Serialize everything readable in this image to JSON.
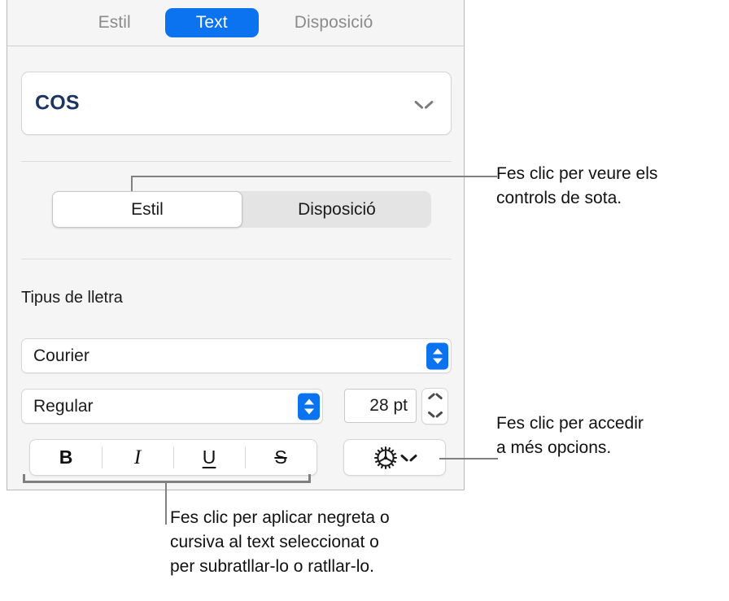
{
  "panel": {
    "top_tabs": [
      {
        "label": "Estil",
        "selected": false
      },
      {
        "label": "Text",
        "selected": true
      },
      {
        "label": "Disposició",
        "selected": false
      }
    ],
    "style_popup": {
      "value": "COS",
      "chevron_icon": "chevron-down-icon",
      "value_color": "#1c3560"
    },
    "segmented_control": [
      {
        "label": "Estil",
        "selected": true
      },
      {
        "label": "Disposició",
        "selected": false
      }
    ],
    "font_section": {
      "label": "Tipus de lletra",
      "family": "Courier",
      "style": "Regular",
      "size": "28 pt",
      "family_stepper_icon": "updown-stepper-icon",
      "style_stepper_icon": "updown-stepper-icon",
      "size_stepper_icon": "updown-chevron-stepper-icon"
    },
    "text_format_buttons": [
      {
        "name": "bold",
        "label": "B"
      },
      {
        "name": "italic",
        "label": "I"
      },
      {
        "name": "underline",
        "label": "U"
      },
      {
        "name": "strikethrough",
        "label": "S"
      }
    ],
    "more_options": {
      "gear_icon": "gear-icon",
      "chevron_icon": "chevron-down-icon"
    }
  },
  "callouts": {
    "segmented": "Fes clic per veure els\ncontrols de sota.",
    "gear": "Fes clic per accedir\na més opcions.",
    "format": "Fes clic per aplicar negreta o\ncursiva al text seleccionat o\nper subratllar-lo o ratllar-lo."
  },
  "colors": {
    "accent": "#0b72f0",
    "panel_bg": "#f5f5f5",
    "leader_line": "#808080"
  }
}
